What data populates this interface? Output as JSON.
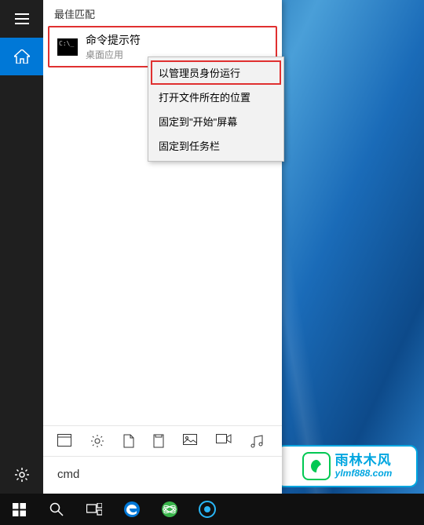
{
  "search": {
    "header": "最佳匹配",
    "query": "cmd",
    "result": {
      "title": "命令提示符",
      "subtitle": "桌面应用"
    }
  },
  "context_menu": {
    "items": [
      "以管理员身份运行",
      "打开文件所在的位置",
      "固定到\"开始\"屏幕",
      "固定到任务栏"
    ]
  },
  "watermark": {
    "cn": "雨林木风",
    "url": "ylmf888.com"
  }
}
